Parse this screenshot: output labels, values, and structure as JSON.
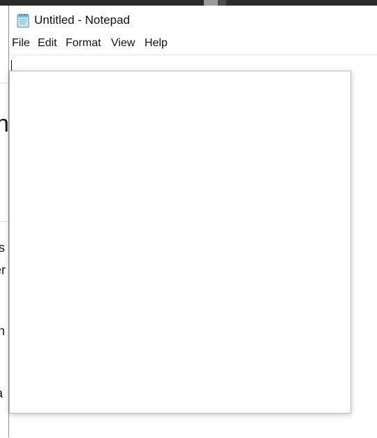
{
  "window": {
    "title": "Untitled - Notepad"
  },
  "menu": [
    {
      "id": "file",
      "label": "File"
    },
    {
      "id": "edit",
      "label": "Edit"
    },
    {
      "id": "format",
      "label": "Format"
    },
    {
      "id": "view",
      "label": "View"
    },
    {
      "id": "help",
      "label": "Help"
    }
  ],
  "editor": {
    "value": ""
  },
  "background_window": {
    "fragments": [
      "n",
      "s",
      "er",
      "h",
      "a"
    ]
  },
  "colors": {
    "title_bar": "#ffffff",
    "text": "#111111",
    "border": "#8c8c8c"
  },
  "icons": {
    "app": "notepad-icon"
  }
}
